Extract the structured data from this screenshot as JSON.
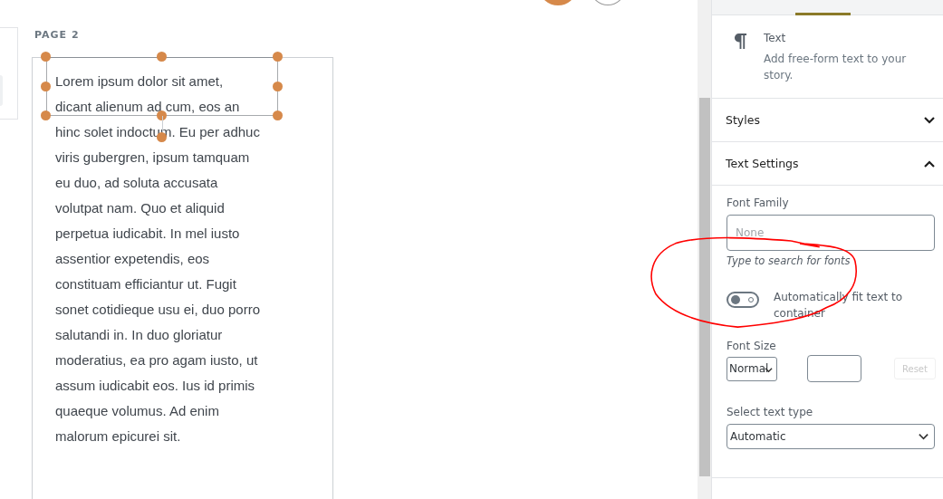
{
  "canvas": {
    "page_label": "PAGE 2",
    "text_block": {
      "selected": true,
      "paragraph": "Lorem ipsum dolor sit amet, dicant alienum ad cum, eos an hinc solet indoctum. Eu per adhuc viris gubergren, ipsum tamquam eu duo, ad soluta accusata volutpat nam. Quo et aliquid perpetua iudicabit. In mel iusto assentior expetendis, eos constituam efficiantur ut. Fugit sonet cotidieque usu ei, duo porro salutandi in. In duo gloriatur moderatius, ea pro agam iusto, ut assum iudicabit eos. Ius id primis quaeque volumus. Ad enim malorum epicurei sit."
    }
  },
  "sidebar": {
    "block": {
      "title": "Text",
      "description": "Add free-form text to your story."
    },
    "panels": [
      {
        "title": "Styles",
        "expanded": false
      },
      {
        "title": "Text Settings",
        "expanded": true
      }
    ],
    "text_settings": {
      "font_family": {
        "label": "Font Family",
        "placeholder": "None",
        "hint": "Type to search for fonts"
      },
      "auto_fit": {
        "label": "Automatically fit text to container",
        "on": false
      },
      "font_size": {
        "label": "Font Size",
        "value": "Normal",
        "reset": "Reset",
        "reset_disabled": true
      },
      "text_type": {
        "label": "Select text type",
        "value": "Automatic"
      }
    }
  }
}
